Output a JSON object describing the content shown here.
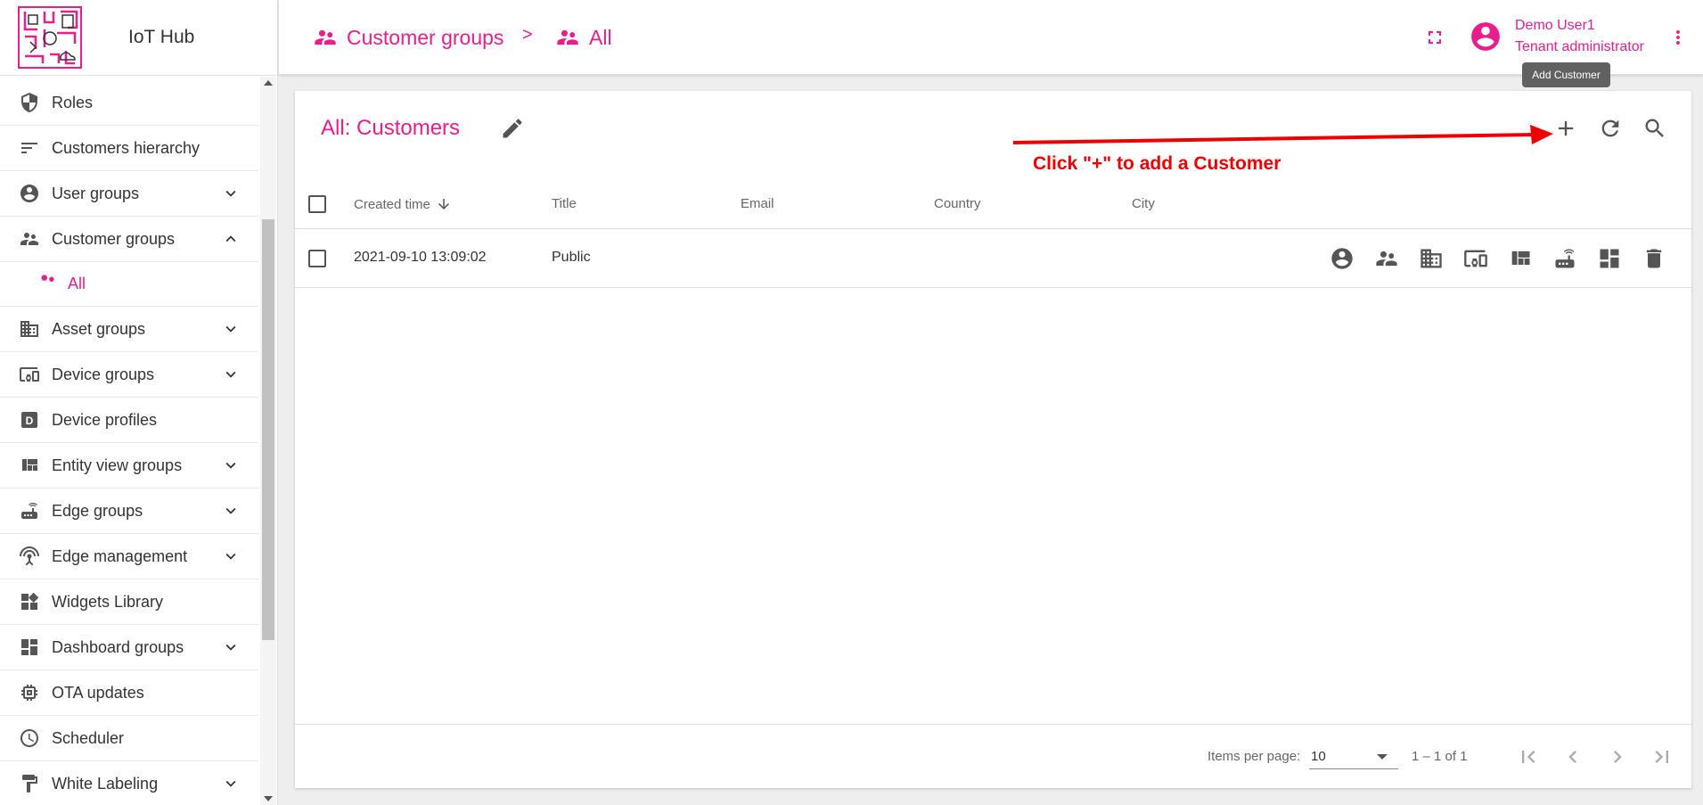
{
  "app": {
    "name": "IoT Hub"
  },
  "sidebar": {
    "items": [
      {
        "label": "Roles",
        "icon": "shield-icon"
      },
      {
        "label": "Customers hierarchy",
        "icon": "sort-lines-icon"
      },
      {
        "label": "User groups",
        "icon": "account-circle-icon",
        "expandable": true
      },
      {
        "label": "Customer groups",
        "icon": "supervisor-account-icon",
        "expandable": true,
        "expanded": true
      },
      {
        "label": "All",
        "icon": "supervisor-account-icon",
        "sub": true,
        "active": true
      },
      {
        "label": "Asset groups",
        "icon": "domain-icon",
        "expandable": true
      },
      {
        "label": "Device groups",
        "icon": "devices-other-icon",
        "expandable": true
      },
      {
        "label": "Device profiles",
        "icon": "device-profile-icon"
      },
      {
        "label": "Entity view groups",
        "icon": "view-quilt-icon",
        "expandable": true
      },
      {
        "label": "Edge groups",
        "icon": "router-icon",
        "expandable": true
      },
      {
        "label": "Edge management",
        "icon": "settings-input-antenna-icon",
        "expandable": true
      },
      {
        "label": "Widgets Library",
        "icon": "widgets-icon"
      },
      {
        "label": "Dashboard groups",
        "icon": "dashboard-icon",
        "expandable": true
      },
      {
        "label": "OTA updates",
        "icon": "memory-icon"
      },
      {
        "label": "Scheduler",
        "icon": "schedule-icon"
      },
      {
        "label": "White Labeling",
        "icon": "format-paint-icon",
        "expandable": true
      }
    ]
  },
  "header": {
    "breadcrumb": [
      {
        "label": "Customer groups",
        "icon": "supervisor-account-icon"
      },
      {
        "label": "All",
        "icon": "supervisor-account-icon"
      }
    ],
    "separator": ">",
    "user_name": "Demo User1",
    "user_role": "Tenant administrator"
  },
  "tooltip": "Add Customer",
  "card": {
    "title": "All: Customers",
    "annotation": "Click \"+\" to add a Customer",
    "columns": [
      "Created time",
      "Title",
      "Email",
      "Country",
      "City"
    ],
    "rows": [
      {
        "created": "2021-09-10 13:09:02",
        "title": "Public",
        "email": "",
        "country": "",
        "city": ""
      }
    ],
    "row_actions": [
      "account-circle-icon",
      "supervisor-account-icon",
      "domain-icon",
      "devices-other-icon",
      "view-quilt-icon",
      "router-icon",
      "dashboard-icon",
      "delete-icon"
    ],
    "footer": {
      "items_per_page_label": "Items per page:",
      "items_per_page": "10",
      "range": "1 – 1 of 1"
    }
  },
  "colors": {
    "accent": "#e91e8c",
    "annotation": "#ee0000"
  }
}
